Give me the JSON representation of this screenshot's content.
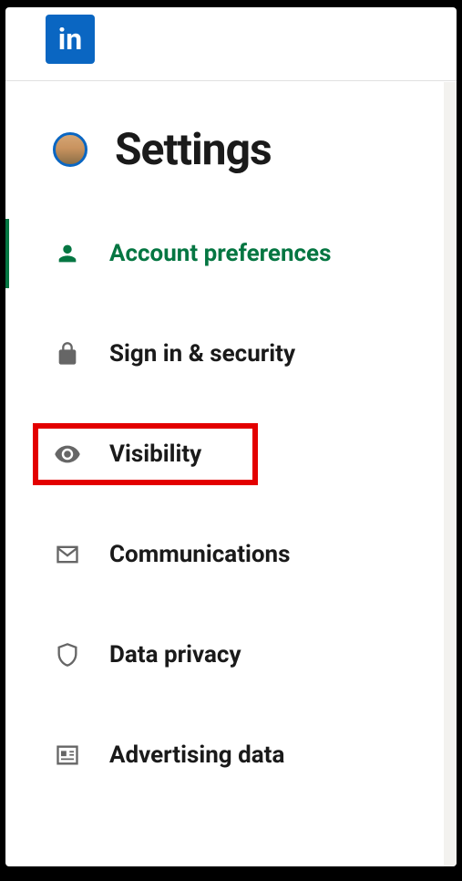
{
  "logo_text": "in",
  "page_title": "Settings",
  "nav": {
    "items": [
      {
        "label": "Account preferences",
        "icon": "person-icon",
        "active": true,
        "highlighted": false
      },
      {
        "label": "Sign in & security",
        "icon": "lock-icon",
        "active": false,
        "highlighted": false
      },
      {
        "label": "Visibility",
        "icon": "eye-icon",
        "active": false,
        "highlighted": true
      },
      {
        "label": "Communications",
        "icon": "envelope-icon",
        "active": false,
        "highlighted": false
      },
      {
        "label": "Data privacy",
        "icon": "shield-icon",
        "active": false,
        "highlighted": false
      },
      {
        "label": "Advertising data",
        "icon": "newspaper-icon",
        "active": false,
        "highlighted": false
      }
    ]
  }
}
